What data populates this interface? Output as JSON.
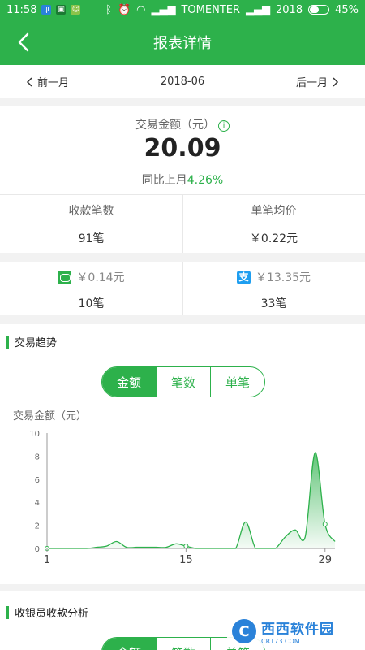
{
  "status_bar": {
    "time": "11:58",
    "carrier": "TOMENTER",
    "year_label": "2018",
    "battery": "45%"
  },
  "header": {
    "title": "报表详情"
  },
  "month_nav": {
    "prev_label": "前一月",
    "current": "2018-06",
    "next_label": "后一月"
  },
  "summary": {
    "amount_label": "交易金额（元）",
    "amount_value": "20.09",
    "yoy_label": "同比上月",
    "yoy_value": "4.26%",
    "count_label": "收款笔数",
    "count_value": "91笔",
    "avg_label": "单笔均价",
    "avg_value": "￥0.22元"
  },
  "payments": {
    "wechat": {
      "icon": "wechat-pay-icon",
      "amount": "￥0.14元",
      "count": "10笔"
    },
    "alipay": {
      "icon": "alipay-icon",
      "glyph": "支",
      "amount": "￥13.35元",
      "count": "33笔"
    }
  },
  "trend": {
    "title": "交易趋势",
    "tabs": [
      "金额",
      "笔数",
      "单笔"
    ],
    "active_tab": "金额",
    "y_axis_label": "交易金额（元）"
  },
  "cashier": {
    "title": "收银员收款分析",
    "tabs": [
      "金额",
      "笔数",
      "单笔"
    ]
  },
  "watermark": {
    "brand": "西西软件园",
    "url": "CR173.COM"
  },
  "colors": {
    "primary": "#2db14b",
    "alipay": "#1e9ef0",
    "text": "#333333",
    "muted": "#666666"
  },
  "chart_data": {
    "type": "area",
    "x": [
      1,
      2,
      3,
      4,
      5,
      6,
      7,
      8,
      9,
      10,
      11,
      12,
      13,
      14,
      15,
      16,
      17,
      18,
      19,
      20,
      21,
      22,
      23,
      24,
      25,
      26,
      27,
      28,
      29,
      30
    ],
    "values": [
      0,
      0,
      0,
      0,
      0,
      0.1,
      0.2,
      0.6,
      0.1,
      0.1,
      0.1,
      0.1,
      0.1,
      0.4,
      0.2,
      0,
      0,
      0,
      0,
      0,
      2.3,
      0,
      0,
      0,
      1,
      1.6,
      1,
      8.3,
      2.1,
      0.6
    ],
    "x_ticks": [
      "1",
      "15",
      "29"
    ],
    "y_ticks": [
      "0",
      "2",
      "4",
      "6",
      "8",
      "10"
    ],
    "ylim": [
      0,
      10
    ],
    "xlim": [
      1,
      30
    ],
    "ylabel": "交易金额（元）",
    "grid": false
  }
}
